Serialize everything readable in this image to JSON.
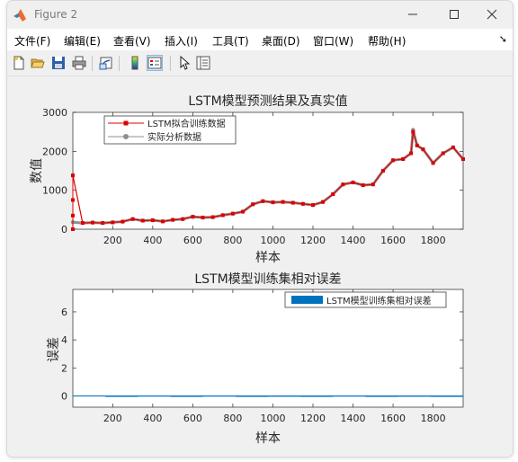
{
  "window": {
    "title": "Figure 2"
  },
  "menu": [
    "文件(F)",
    "编辑(E)",
    "查看(V)",
    "插入(I)",
    "工具(T)",
    "桌面(D)",
    "窗口(W)",
    "帮助(H)"
  ],
  "toolbar_icons": [
    "new-figure-icon",
    "open-file-icon",
    "save-icon",
    "print-icon",
    "link-icon",
    "colorbar-icon",
    "legend-icon",
    "pointer-icon",
    "property-inspector-icon"
  ],
  "colors": {
    "predicted": "#dd0000",
    "actual": "#8f8f8f",
    "error_bar": "#0072bd",
    "text": "#262626",
    "axes_bg": "#ffffff"
  },
  "chart_data": [
    {
      "type": "line",
      "title": "LSTM模型预测结果及真实值",
      "xlabel": "样本",
      "ylabel": "数值",
      "xlim": [
        1,
        1950
      ],
      "ylim": [
        0,
        3000
      ],
      "xticks": [
        "200",
        "400",
        "600",
        "800",
        "1000",
        "1200",
        "1400",
        "1600",
        "1800"
      ],
      "yticks": [
        "0",
        "1000",
        "2000",
        "3000"
      ],
      "legend_position": "top-left",
      "series": [
        {
          "name": "LSTM拟合训练数据",
          "marker": "square",
          "x": [
            1,
            50,
            100,
            150,
            200,
            250,
            300,
            350,
            400,
            450,
            500,
            550,
            600,
            650,
            700,
            750,
            800,
            850,
            900,
            950,
            1000,
            1050,
            1100,
            1150,
            1200,
            1250,
            1300,
            1350,
            1400,
            1450,
            1500,
            1550,
            1600,
            1650,
            1690,
            1700,
            1720,
            1750,
            1800,
            1850,
            1900,
            1950
          ],
          "values": [
            1380,
            160,
            170,
            160,
            175,
            195,
            260,
            220,
            230,
            200,
            240,
            260,
            320,
            300,
            310,
            360,
            400,
            450,
            640,
            720,
            690,
            700,
            680,
            650,
            620,
            700,
            900,
            1150,
            1200,
            1130,
            1150,
            1500,
            1770,
            1800,
            1950,
            2500,
            2150,
            2050,
            1700,
            1950,
            2100,
            1800
          ]
        },
        {
          "name": "实际分析数据",
          "marker": "circle",
          "x": [
            1,
            50,
            100,
            150,
            200,
            250,
            300,
            350,
            400,
            450,
            500,
            550,
            600,
            650,
            700,
            750,
            800,
            850,
            900,
            950,
            1000,
            1050,
            1100,
            1150,
            1200,
            1250,
            1300,
            1350,
            1400,
            1450,
            1500,
            1550,
            1600,
            1650,
            1690,
            1700,
            1720,
            1750,
            1800,
            1850,
            1900,
            1950
          ],
          "values": [
            180,
            160,
            170,
            160,
            175,
            195,
            260,
            220,
            230,
            200,
            240,
            260,
            320,
            300,
            310,
            360,
            400,
            450,
            640,
            720,
            690,
            700,
            680,
            650,
            620,
            700,
            900,
            1150,
            1200,
            1130,
            1150,
            1500,
            1770,
            1800,
            1950,
            2550,
            2150,
            2050,
            1700,
            1950,
            2100,
            1800
          ]
        }
      ]
    },
    {
      "type": "bar",
      "title": "LSTM模型训练集相对误差",
      "xlabel": "样本",
      "ylabel": "误差",
      "xlim": [
        1,
        1950
      ],
      "ylim": [
        -0.8,
        7.6
      ],
      "xticks": [
        "200",
        "400",
        "600",
        "800",
        "1000",
        "1200",
        "1400",
        "1600",
        "1800"
      ],
      "yticks": [
        "0",
        "2",
        "4",
        "6"
      ],
      "legend_position": "top-right",
      "series": [
        {
          "name": "LSTM模型训练集相对误差",
          "values": [
            0.03,
            -0.02,
            0.02,
            -0.03,
            0.02,
            -0.01,
            0.01,
            -0.02,
            0.02,
            -0.01,
            0.01,
            -0.01
          ]
        }
      ]
    }
  ]
}
